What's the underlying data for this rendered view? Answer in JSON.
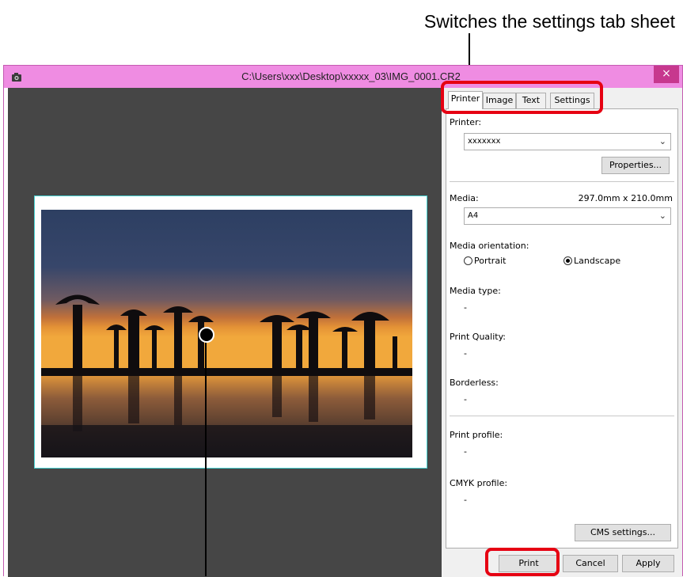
{
  "callouts": {
    "tab_sheet": "Switches the settings tab sheet"
  },
  "window": {
    "title": "C:\\Users\\xxx\\Desktop\\xxxxx_03\\IMG_0001.CR2",
    "close_glyph": "×",
    "app_icon": "camera-app-icon"
  },
  "tabs": [
    {
      "label": "Printer",
      "active": true
    },
    {
      "label": "Image",
      "active": false
    },
    {
      "label": "Text",
      "active": false
    },
    {
      "label": "Settings",
      "active": false
    }
  ],
  "printer": {
    "label": "Printer:",
    "selected": "xxxxxxx",
    "properties_button": "Properties..."
  },
  "media": {
    "label": "Media:",
    "size": "297.0mm x 210.0mm",
    "selected": "A4"
  },
  "orientation": {
    "label": "Media orientation:",
    "portrait": "Portrait",
    "landscape": "Landscape",
    "selected": "Landscape"
  },
  "media_type": {
    "label": "Media type:",
    "value": "-"
  },
  "print_quality": {
    "label": "Print Quality:",
    "value": "-"
  },
  "borderless": {
    "label": "Borderless:",
    "value": "-"
  },
  "print_profile": {
    "label": "Print profile:",
    "value": "-"
  },
  "cmyk_profile": {
    "label": "CMYK profile:",
    "value": "-"
  },
  "cms_button": "CMS settings...",
  "footer": {
    "print": "Print",
    "cancel": "Cancel",
    "apply": "Apply"
  },
  "colors": {
    "titlebar": "#ef8ce2",
    "close": "#c7388e",
    "highlight": "#e60012",
    "preview_bg": "#464646",
    "paper_border": "#46d1d1"
  }
}
